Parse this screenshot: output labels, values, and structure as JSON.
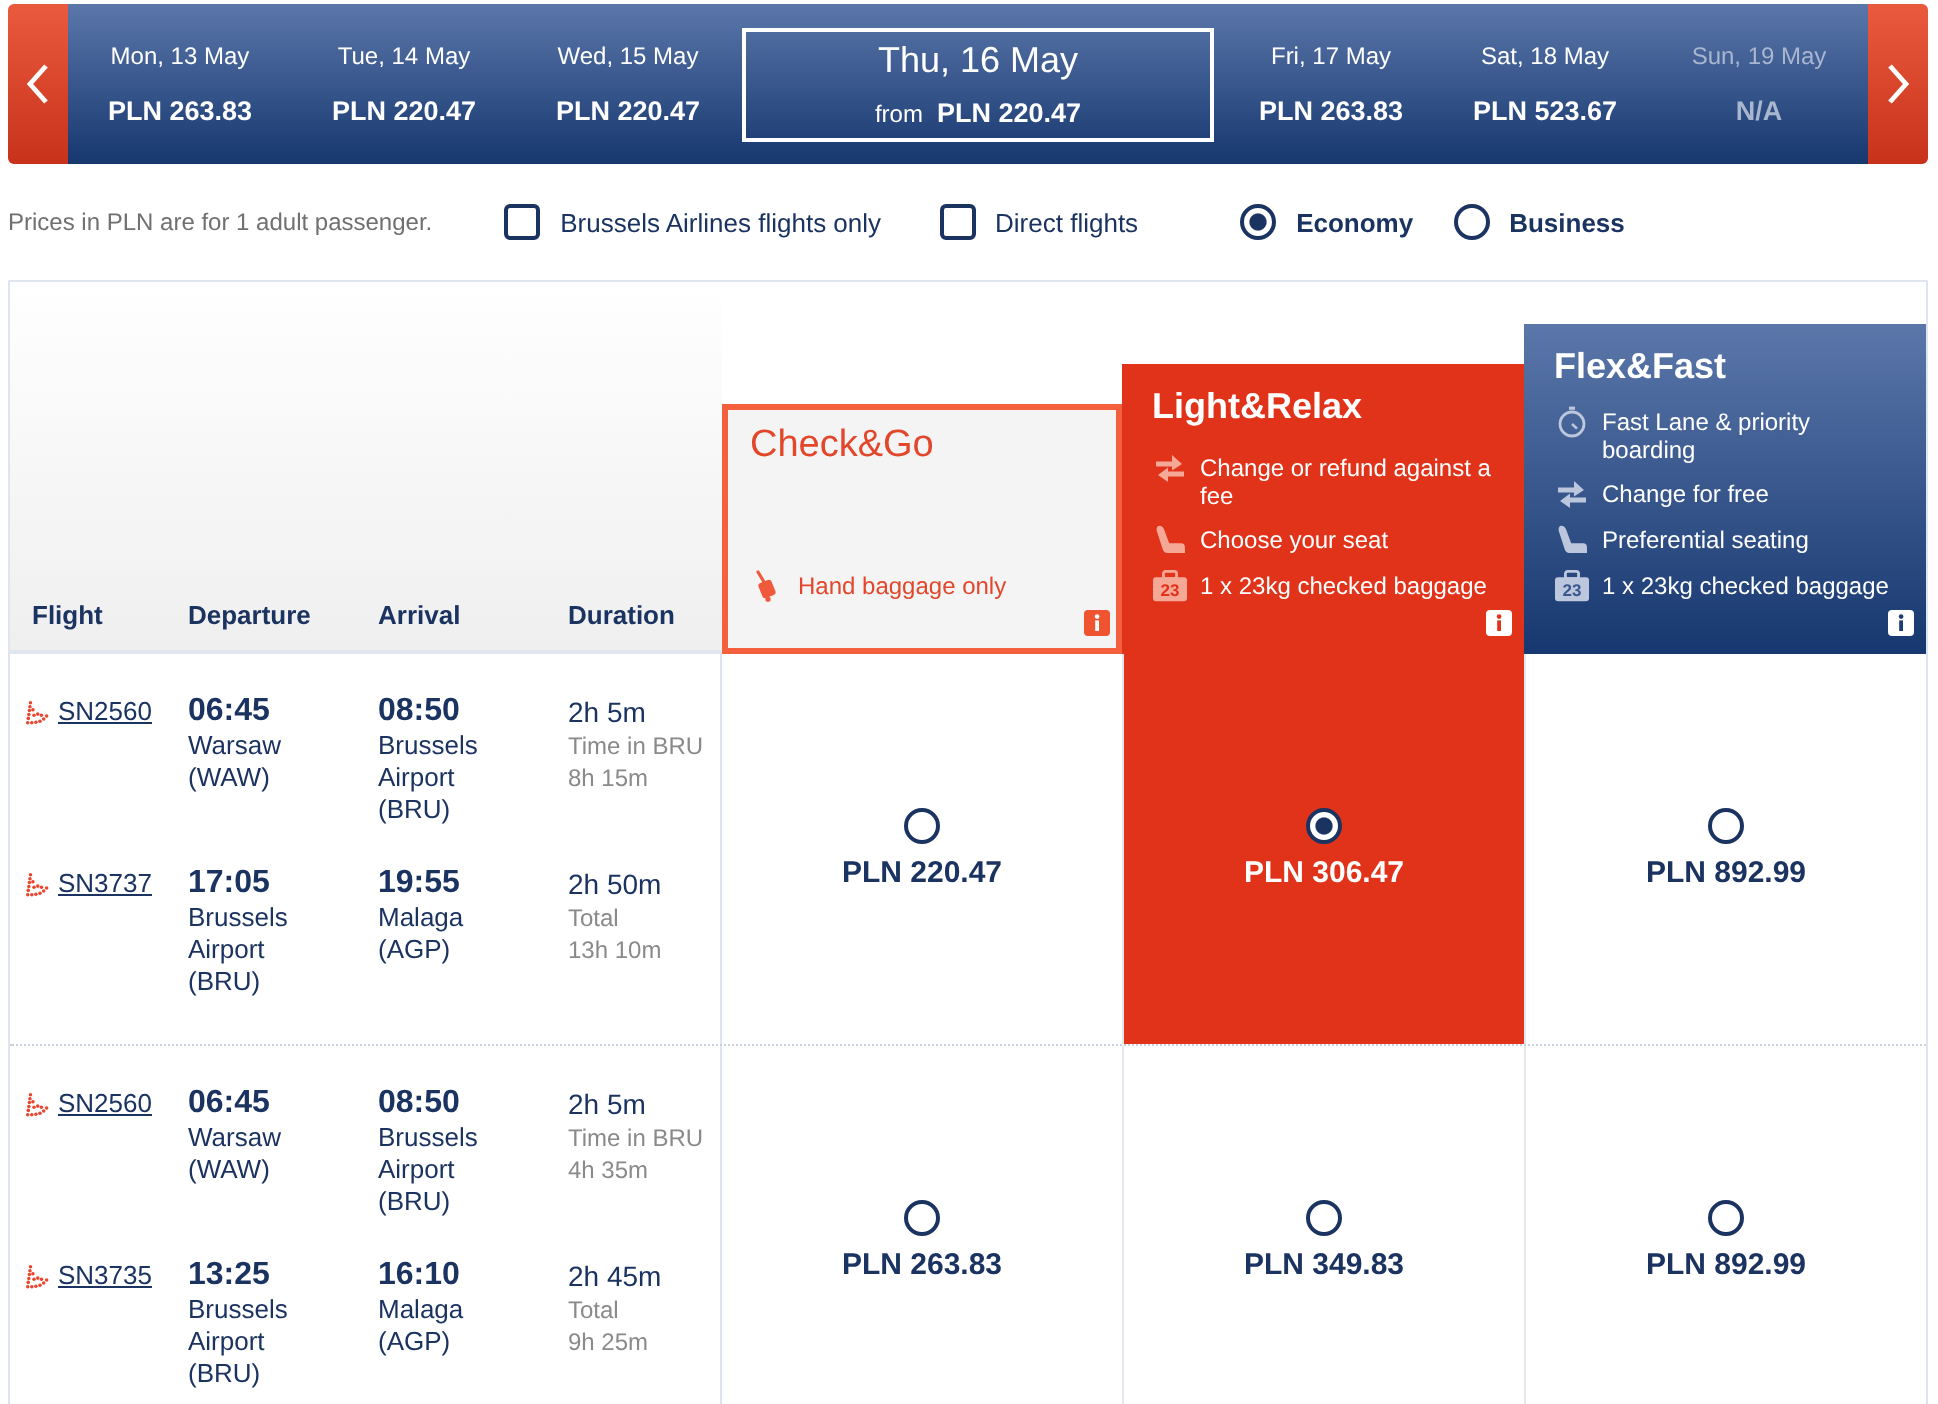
{
  "date_bar": {
    "days": [
      {
        "date": "Mon, 13 May",
        "price": "PLN 263.83",
        "selected": false,
        "available": true
      },
      {
        "date": "Tue, 14 May",
        "price": "PLN 220.47",
        "selected": false,
        "available": true
      },
      {
        "date": "Wed, 15 May",
        "price": "PLN 220.47",
        "selected": false,
        "available": true
      },
      {
        "date": "Thu, 16 May",
        "prefix": "from",
        "price": "PLN 220.47",
        "selected": true,
        "available": true
      },
      {
        "date": "Fri, 17 May",
        "price": "PLN 263.83",
        "selected": false,
        "available": true
      },
      {
        "date": "Sat, 18 May",
        "price": "PLN 523.67",
        "selected": false,
        "available": true
      },
      {
        "date": "Sun, 19 May",
        "price": "N/A",
        "selected": false,
        "available": false
      }
    ]
  },
  "filters": {
    "note": "Prices in PLN are for 1 adult passenger.",
    "checkboxes": [
      {
        "label": "Brussels Airlines flights only",
        "checked": false
      },
      {
        "label": "Direct flights",
        "checked": false
      }
    ],
    "cabins": [
      {
        "label": "Economy",
        "selected": true
      },
      {
        "label": "Business",
        "selected": false
      }
    ]
  },
  "table": {
    "columns": [
      "Flight",
      "Departure",
      "Arrival",
      "Duration"
    ],
    "fares": [
      {
        "name": "Check&Go",
        "kind": "outline",
        "features": [
          {
            "kind": "trolley",
            "text": "Hand baggage only"
          }
        ]
      },
      {
        "name": "Light&Relax",
        "kind": "solid",
        "features": [
          {
            "kind": "swap",
            "text": "Change or refund against a fee"
          },
          {
            "kind": "seat",
            "text": "Choose your seat"
          },
          {
            "kind": "bag",
            "icon_text": "23",
            "text": "1 x 23kg checked baggage"
          }
        ]
      },
      {
        "name": "Flex&Fast",
        "kind": "gradient",
        "features": [
          {
            "kind": "stopwatch",
            "text": "Fast Lane & priority boarding"
          },
          {
            "kind": "swap",
            "text": "Change for free"
          },
          {
            "kind": "seat",
            "text": "Preferential seating"
          },
          {
            "kind": "bag",
            "icon_text": "23",
            "text": "1 x 23kg checked baggage"
          }
        ]
      }
    ],
    "rows": [
      {
        "segments": [
          {
            "flight": "SN2560",
            "departure_time": "06:45",
            "departure_place": "Warsaw (WAW)",
            "arrival_time": "08:50",
            "arrival_place": "Brussels Airport (BRU)",
            "duration": "2h 5m",
            "note_label": "Time in BRU",
            "note_value": "8h 15m"
          },
          {
            "flight": "SN3737",
            "departure_time": "17:05",
            "departure_place": "Brussels Airport (BRU)",
            "arrival_time": "19:55",
            "arrival_place": "Malaga (AGP)",
            "duration": "2h 50m",
            "note_label": "Total",
            "note_value": "13h 10m"
          }
        ],
        "prices": [
          {
            "price": "PLN 220.47",
            "selected": false
          },
          {
            "price": "PLN 306.47",
            "selected": true
          },
          {
            "price": "PLN 892.99",
            "selected": false
          }
        ]
      },
      {
        "segments": [
          {
            "flight": "SN2560",
            "departure_time": "06:45",
            "departure_place": "Warsaw (WAW)",
            "arrival_time": "08:50",
            "arrival_place": "Brussels Airport (BRU)",
            "duration": "2h 5m",
            "note_label": "Time in BRU",
            "note_value": "4h 35m"
          },
          {
            "flight": "SN3735",
            "departure_time": "13:25",
            "departure_place": "Brussels Airport (BRU)",
            "arrival_time": "16:10",
            "arrival_place": "Malaga (AGP)",
            "duration": "2h 45m",
            "note_label": "Total",
            "note_value": "9h 25m"
          }
        ],
        "prices": [
          {
            "price": "PLN 263.83",
            "selected": false
          },
          {
            "price": "PLN 349.83",
            "selected": false
          },
          {
            "price": "PLN 892.99",
            "selected": false
          }
        ]
      }
    ]
  }
}
